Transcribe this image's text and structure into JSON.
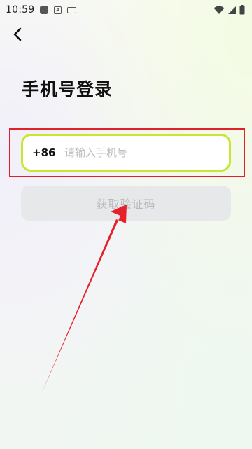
{
  "status_bar": {
    "time": "10:59",
    "notif_letter": "A"
  },
  "header": {
    "back_icon": "chevron-left-icon"
  },
  "title": "手机号登录",
  "phone": {
    "country_code": "+86",
    "placeholder": "请输入手机号",
    "value": ""
  },
  "get_code_button": "获取验证码",
  "colors": {
    "field_border": "#c9e635",
    "annotation_red": "#e0202a",
    "button_bg": "#e6e8e9",
    "button_text": "#b8babc"
  }
}
